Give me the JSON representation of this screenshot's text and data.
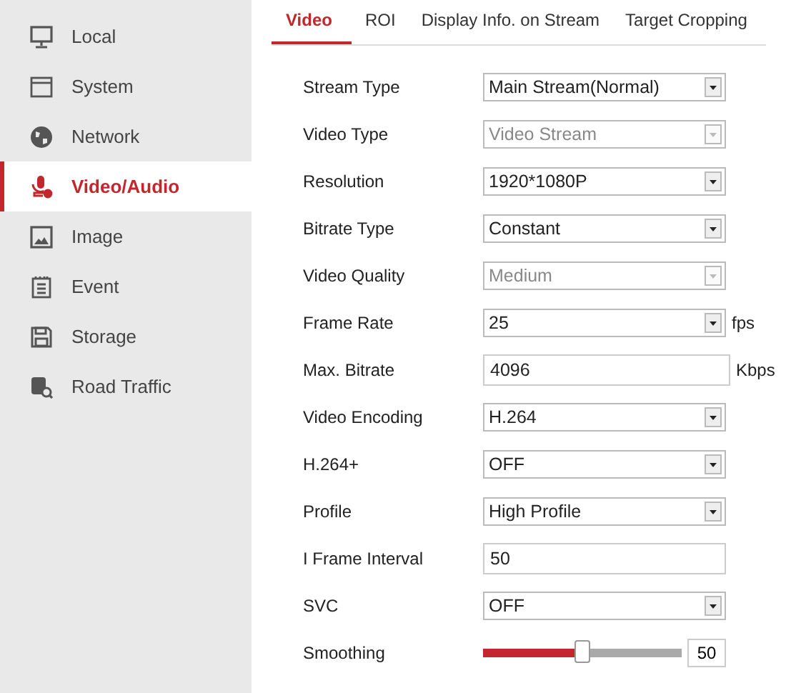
{
  "sidebar": {
    "items": [
      {
        "label": "Local",
        "selected": false
      },
      {
        "label": "System",
        "selected": false
      },
      {
        "label": "Network",
        "selected": false
      },
      {
        "label": "Video/Audio",
        "selected": true
      },
      {
        "label": "Image",
        "selected": false
      },
      {
        "label": "Event",
        "selected": false
      },
      {
        "label": "Storage",
        "selected": false
      },
      {
        "label": "Road Traffic",
        "selected": false
      }
    ]
  },
  "tabs": [
    {
      "label": "Video",
      "selected": true
    },
    {
      "label": "ROI",
      "selected": false
    },
    {
      "label": "Display Info. on Stream",
      "selected": false
    },
    {
      "label": "Target Cropping",
      "selected": false
    }
  ],
  "fields": [
    {
      "kind": "select",
      "label": "Stream Type",
      "value": "Main  Stream(Normal)",
      "disabled": false
    },
    {
      "kind": "select",
      "label": "Video Type",
      "value": "Video Stream",
      "disabled": true
    },
    {
      "kind": "select",
      "label": "Resolution",
      "value": "1920*1080P",
      "disabled": false
    },
    {
      "kind": "select",
      "label": "Bitrate Type",
      "value": "Constant",
      "disabled": false
    },
    {
      "kind": "select",
      "label": "Video Quality",
      "value": "Medium",
      "disabled": true
    },
    {
      "kind": "select",
      "label": "Frame Rate",
      "value": "25",
      "disabled": false,
      "unit": "fps"
    },
    {
      "kind": "text",
      "label": "Max. Bitrate",
      "value": "4096",
      "unit": "Kbps"
    },
    {
      "kind": "select",
      "label": "Video Encoding",
      "value": "H.264",
      "disabled": false
    },
    {
      "kind": "select",
      "label": "H.264+",
      "value": "OFF",
      "disabled": false
    },
    {
      "kind": "select",
      "label": "Profile",
      "value": "High Profile",
      "disabled": false
    },
    {
      "kind": "text",
      "label": "I Frame Interval",
      "value": "50"
    },
    {
      "kind": "select",
      "label": "SVC",
      "value": "OFF",
      "disabled": false
    },
    {
      "kind": "slider",
      "label": "Smoothing",
      "value": "50",
      "level": 0.5
    }
  ]
}
